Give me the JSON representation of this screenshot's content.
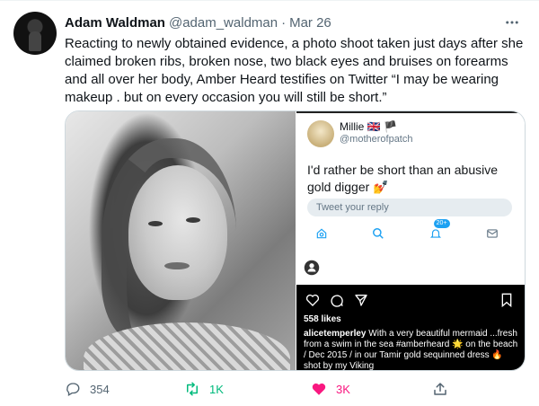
{
  "tweet": {
    "author_name": "Adam Waldman",
    "handle": "@adam_waldman",
    "separator": "·",
    "date": "Mar 26",
    "text": "Reacting to newly obtained evidence, a photo shoot taken just days after she claimed broken ribs, broken nose, two black eyes and bruises on forearms and all over her body, Amber Heard testifies on Twitter “I may be wearing makeup . but on every occasion you will still be short.”"
  },
  "embedded_screenshot": {
    "name": "Millie 🇬🇧 🏴",
    "handle": "@motherofpatch",
    "text": "I'd rather be short than an abusive gold digger 💅",
    "reply_placeholder": "Tweet your reply",
    "notification_badge": "20+",
    "likes": "558 likes",
    "caption_user": "alicetemperley",
    "caption_text": " With a very beautiful mermaid ...fresh from a swim in the sea #amberheard 🌟 on the beach / Dec 2015 / in our Tamir  gold sequinned dress 🔥 shot by my Viking"
  },
  "actions": {
    "reply_count": "354",
    "retweet_count": "1K",
    "like_count": "3K"
  },
  "colors": {
    "retweet": "#00ba7c",
    "like": "#f91880",
    "muted": "#536471"
  }
}
